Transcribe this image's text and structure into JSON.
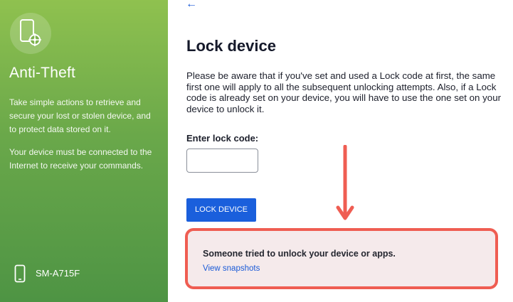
{
  "sidebar": {
    "icon": "phone-target-icon",
    "title": "Anti-Theft",
    "description_1": "Take simple actions to retrieve and secure your lost or stolen device, and to protect data stored on it.",
    "description_2": "Your device must be connected to the Internet to receive your commands.",
    "device_icon": "smartphone-icon",
    "device_name": "SM-A715F"
  },
  "main": {
    "back_icon": "back-arrow-icon",
    "back_symbol": "←",
    "title": "Lock device",
    "info": "Please be aware that if you've set and used a Lock code at first, the same first one will apply to all the subsequent unlocking attempts. Also, if a Lock code is already set on your device, you will have to use the one set on your device to unlock it.",
    "code_label": "Enter lock code:",
    "code_value": "",
    "lock_button": "LOCK DEVICE"
  },
  "alert": {
    "title": "Someone tried to unlock your device or apps.",
    "link": "View snapshots"
  },
  "annotation": {
    "icon": "arrow-down-icon"
  },
  "colors": {
    "sidebar_top": "#8fc14f",
    "sidebar_bottom": "#4e9444",
    "accent_blue": "#1a5fdc",
    "alert_border": "#ef5d52",
    "alert_bg": "#f5eaeb"
  }
}
